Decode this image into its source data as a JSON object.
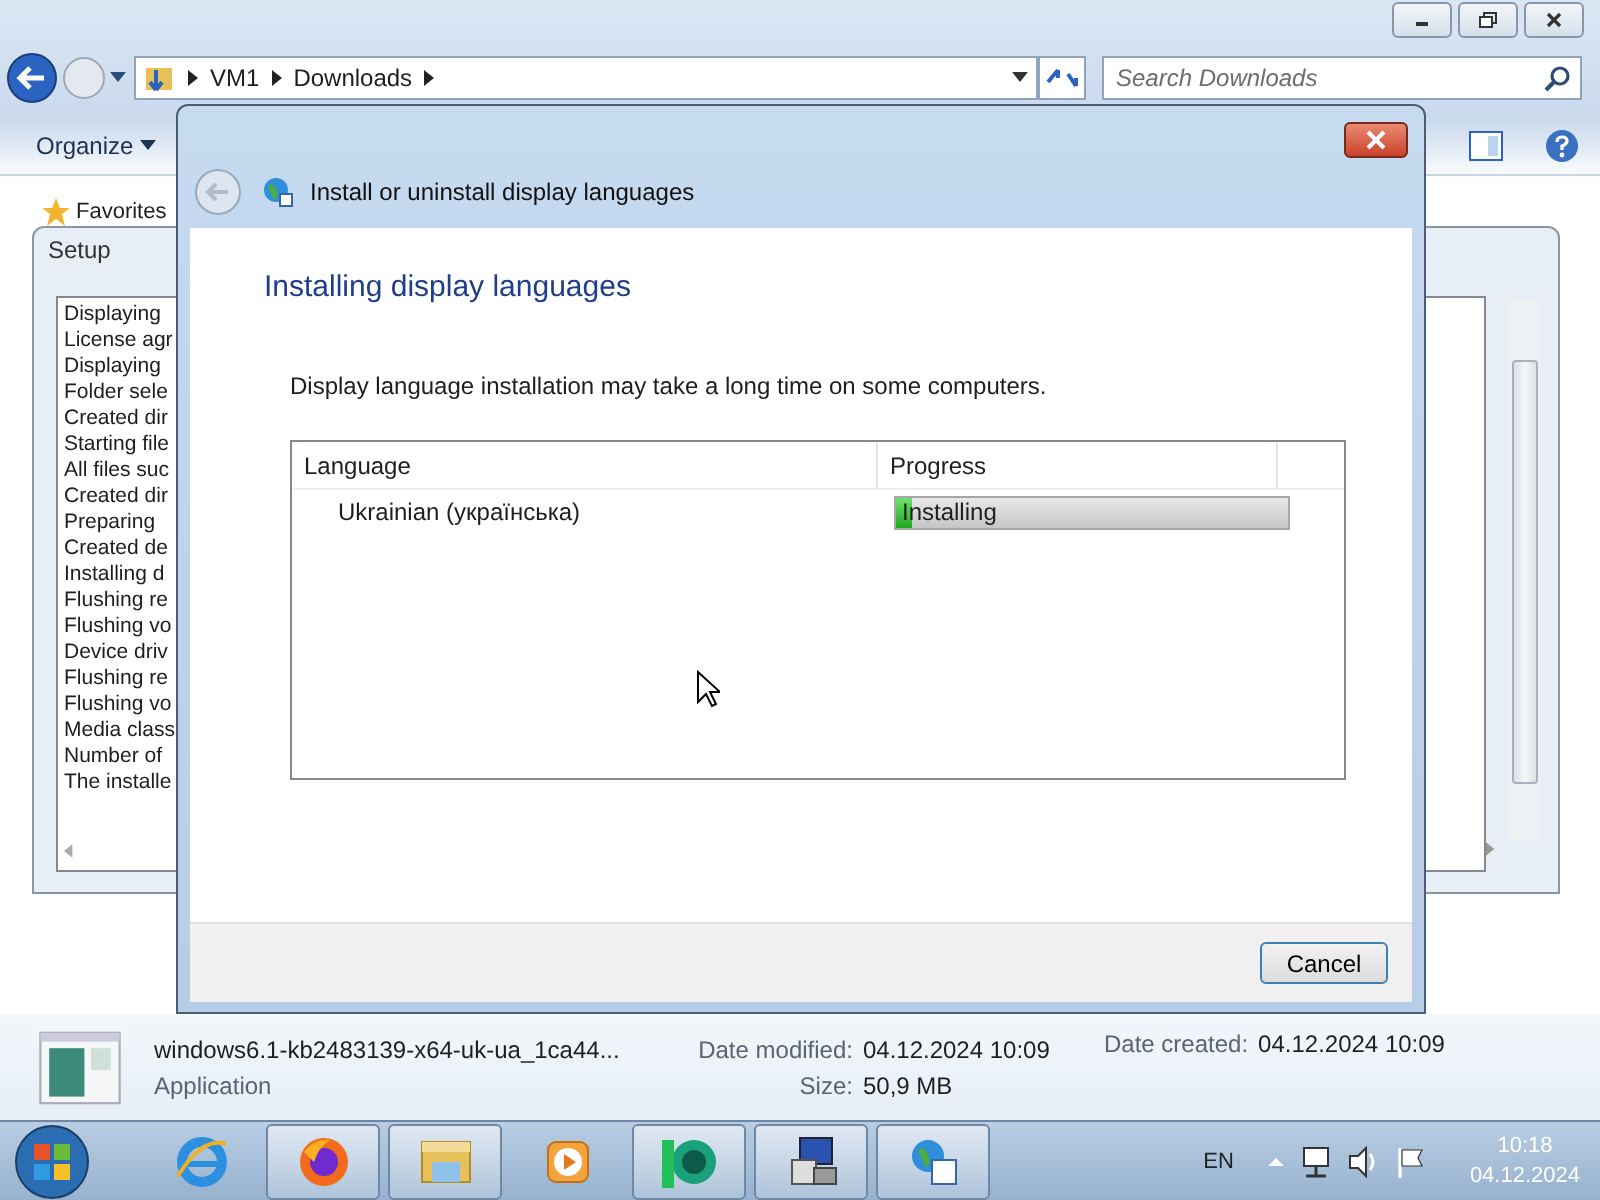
{
  "explorer": {
    "address": [
      "VM1",
      "Downloads"
    ],
    "search": {
      "placeholder": "Search Downloads"
    },
    "organize": "Organize",
    "favorites": "Favorites"
  },
  "setup": {
    "title": "Setup",
    "log": [
      "Displaying",
      "License agr",
      "Displaying",
      "Folder sele",
      "Created dir",
      "Starting file",
      "All files suc",
      "Created dir",
      "Preparing",
      "Created de",
      "Installing d",
      "Flushing re",
      "Flushing vo",
      "Device driv",
      "Flushing re",
      "Flushing vo",
      "Media class",
      "Number of",
      "The installe"
    ]
  },
  "dialog": {
    "title": "Install or uninstall display languages",
    "heading": "Installing display languages",
    "note": "Display language installation may take a long time on some computers.",
    "columns": [
      "Language",
      "Progress"
    ],
    "rows": [
      {
        "language": "Ukrainian (українська)",
        "status": "Installing",
        "level": 0.04
      }
    ],
    "buttons": [
      "Cancel"
    ]
  },
  "details": {
    "name": "windows6.1-kb2483139-x64-uk-ua_1ca44...",
    "type": "Application",
    "modified_label": "Date modified:",
    "modified": "04.12.2024 10:09",
    "size_label": "Size:",
    "size": "50,9 MB",
    "created_label": "Date created:",
    "created": "04.12.2024 10:09"
  },
  "taskbar": {
    "apps": [
      {
        "kind": "ie",
        "running": false
      },
      {
        "kind": "firefox",
        "running": true
      },
      {
        "kind": "folder",
        "running": true
      },
      {
        "kind": "media",
        "running": false
      },
      {
        "kind": "green",
        "running": true
      },
      {
        "kind": "setup",
        "running": true
      },
      {
        "kind": "language",
        "running": true
      }
    ],
    "language": "EN",
    "time": "10:18",
    "date": "04.12.2024"
  }
}
